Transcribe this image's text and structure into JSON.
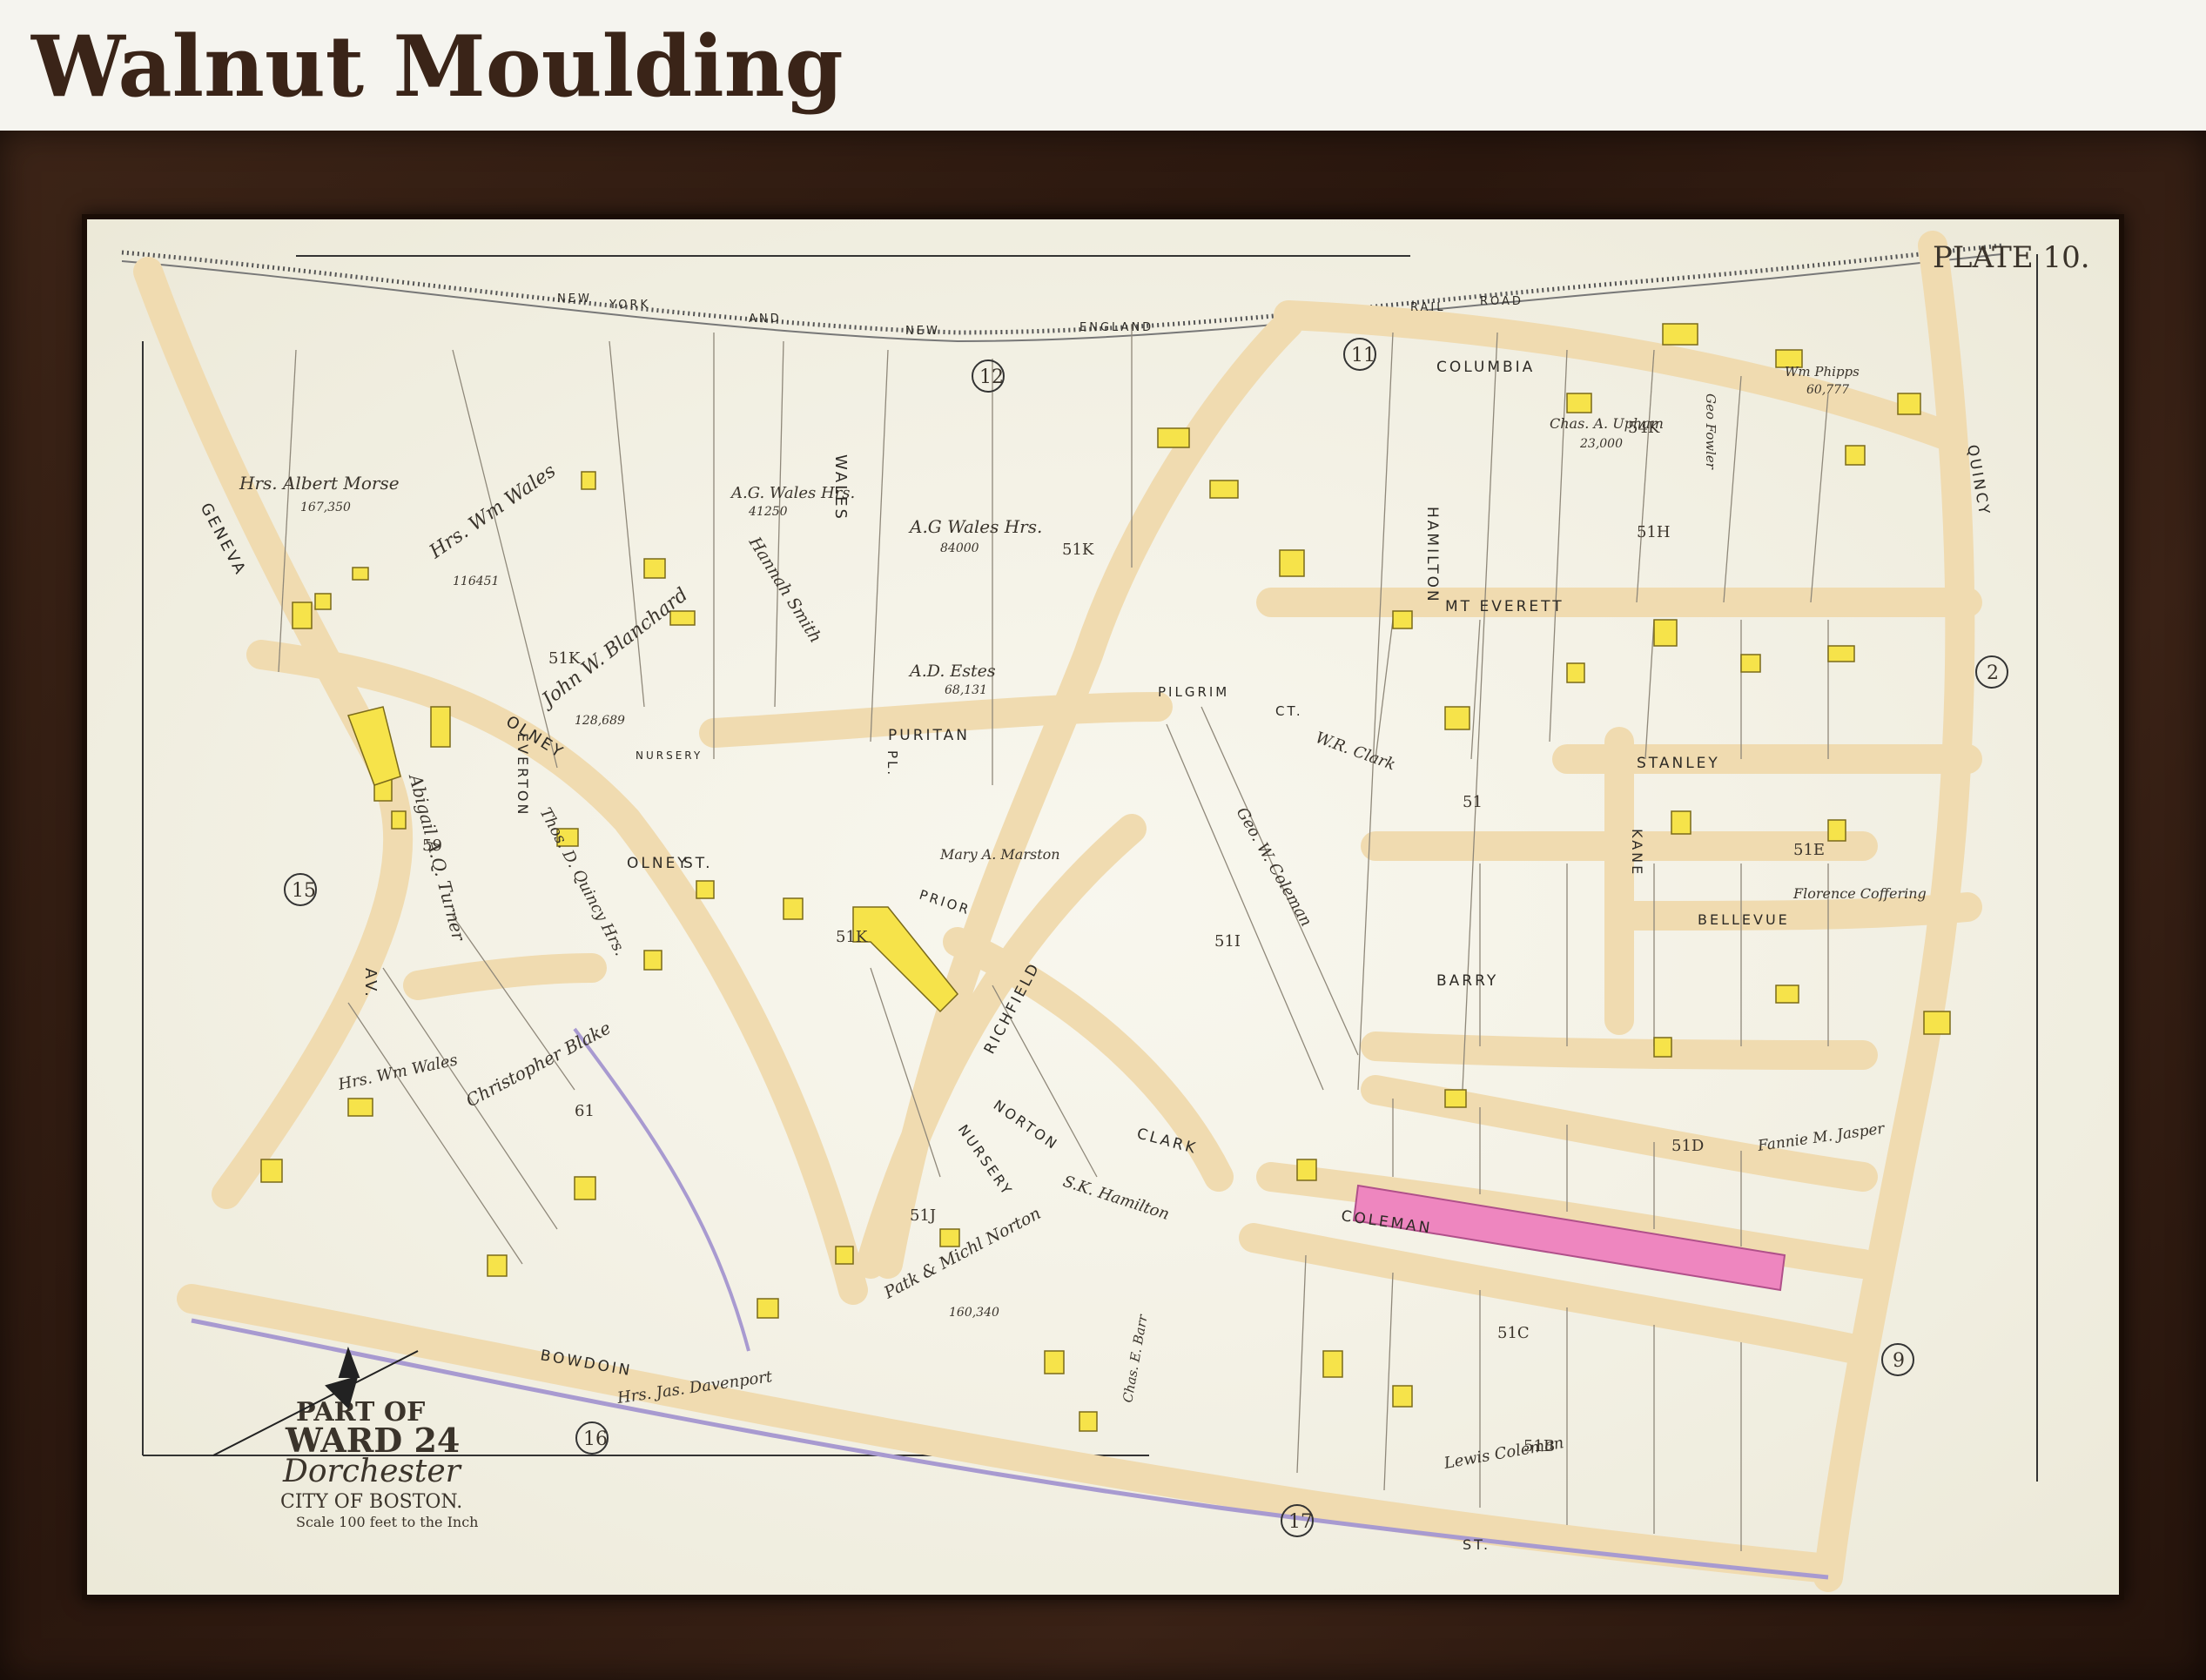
{
  "header": {
    "title": "Walnut Moulding"
  },
  "map": {
    "plate": "PLATE 10.",
    "cartouche": {
      "line1": "PART OF",
      "line2": "WARD 24",
      "line3": "Dorchester",
      "line4": "CITY OF BOSTON.",
      "scale": "Scale 100 feet to the Inch"
    },
    "adjacent_plates": [
      "12",
      "11",
      "2",
      "15",
      "16",
      "17",
      "9"
    ],
    "streets": {
      "geneva": "GENEVA",
      "av": "AV.",
      "olney": "OLNEY",
      "olney_st": "OLNEY",
      "everton": "EVERTON",
      "wales": "WALES",
      "pl": "PL.",
      "puritan": "PURITAN",
      "pilgrim": "PILGRIM",
      "ct": "CT.",
      "richfield": "RICHFIELD",
      "norton": "NORTON",
      "prior": "PRIOR",
      "clark": "CLARK",
      "st": "ST.",
      "hamilton": "HAMILTON",
      "columbia": "COLUMBIA",
      "quincy": "QUINCY",
      "mt_everett": "MT EVERETT",
      "stanley": "STANLEY",
      "kane": "KANE",
      "bellevue": "BELLEVUE",
      "barry": "BARRY",
      "coleman": "COLEMAN",
      "bowdoin": "BOWDOIN",
      "railroad": [
        "NEW",
        "YORK",
        "AND",
        "NEW",
        "ENGLAND",
        "RAIL",
        "ROAD"
      ]
    },
    "blocks": [
      "51K",
      "51K",
      "51K",
      "51J",
      "51I",
      "51H",
      "51E",
      "51D",
      "51C",
      "51B",
      "51",
      "59",
      "61",
      "54K"
    ],
    "owners": [
      "Hrs. Albert Morse",
      "Hrs. Wm Wales",
      "John W. Blanchard",
      "A.G. Wales Hrs.",
      "A.G Wales Hrs.",
      "Hannah Smith",
      "A.D. Estes",
      "Abigail A.Q. Turner",
      "Thos. D. Quincy Hrs.",
      "Christopher Blake",
      "Hrs. Wm Wales",
      "Hrs. Jas. Davenport",
      "Patk & Michl Norton",
      "Lewis Coleman",
      "S.K. Hamilton",
      "W.R. Clark",
      "Geo. W. Coleman",
      "Chas. A. Upham",
      "Fannie M. Jasper",
      "Florence Coffering",
      "Wm Phipps",
      "Geo Fowler",
      "Chas. E. Barr",
      "Mary A. Marston"
    ],
    "areas": [
      "167,350",
      "116451",
      "128,689",
      "41250",
      "84000",
      "68,131",
      "160,340",
      "23,000",
      "60,777"
    ],
    "labels_misc": [
      "NURSERY",
      "NURSERY"
    ]
  }
}
